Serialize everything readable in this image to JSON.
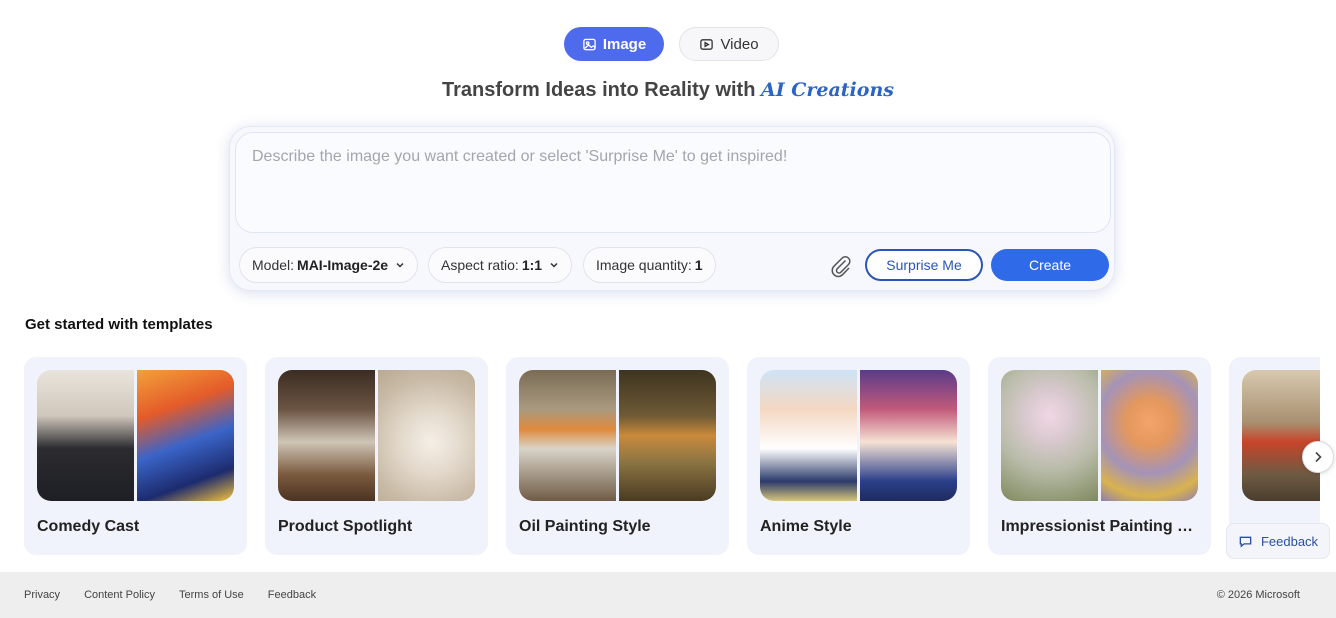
{
  "mode_toggle": {
    "image_label": "Image",
    "video_label": "Video",
    "active": "Image",
    "accent_color": "#4f6bed"
  },
  "headline": {
    "text": "Transform Ideas into Reality with ",
    "accent": "AI Creations"
  },
  "prompt": {
    "value": "",
    "placeholder": "Describe the image you want created or select 'Surprise Me' to get inspired!"
  },
  "options": {
    "model_label": "Model:",
    "model_value": "MAI-Image-2e",
    "aspect_label": "Aspect ratio:",
    "aspect_value": "1:1",
    "quantity_label": "Image quantity:",
    "quantity_value": "1"
  },
  "actions": {
    "attach_icon": "paperclip-icon",
    "surprise_label": "Surprise Me",
    "create_label": "Create",
    "create_color": "#2f6ae8"
  },
  "templates": {
    "title": "Get started with templates",
    "items": [
      {
        "label": "Comedy Cast"
      },
      {
        "label": "Product Spotlight"
      },
      {
        "label": "Oil Painting Style"
      },
      {
        "label": "Anime Style"
      },
      {
        "label": "Impressionist Painting St..."
      },
      {
        "label": ""
      }
    ],
    "next_icon": "chevron-right-icon"
  },
  "feedback_button": {
    "label": "Feedback",
    "icon": "chat-bubble-icon"
  },
  "footer": {
    "links": [
      "Privacy",
      "Content Policy",
      "Terms of Use",
      "Feedback"
    ],
    "copyright": "© 2026 Microsoft"
  }
}
